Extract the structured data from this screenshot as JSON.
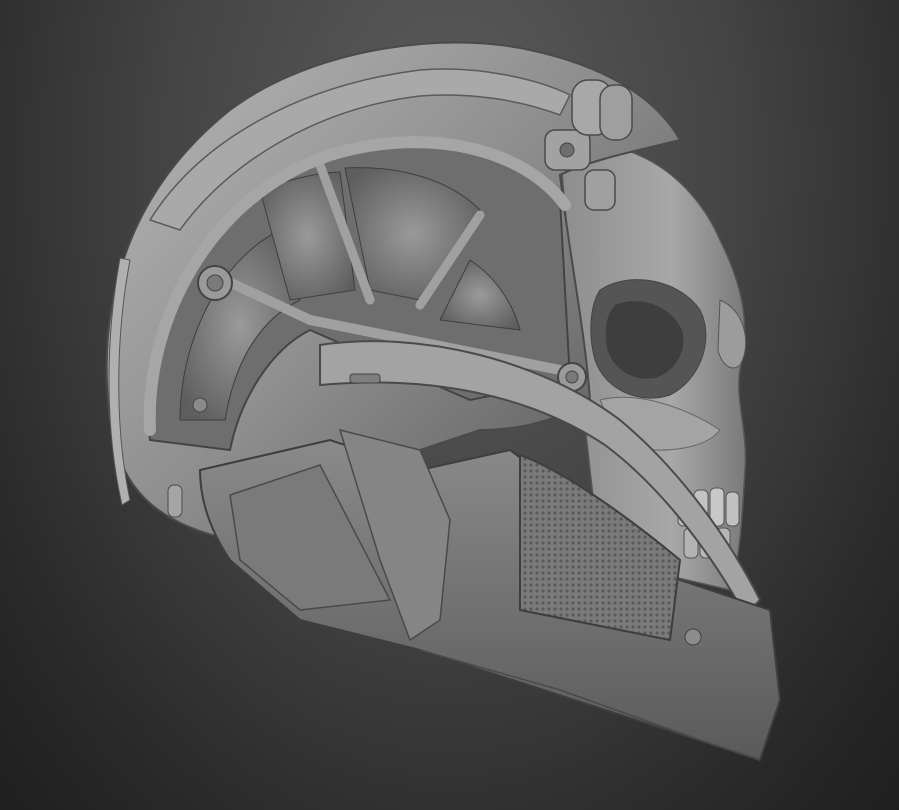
{
  "viewport": {
    "subject": "sculpted-helmet-skull",
    "background_top": "#5c5c5c",
    "background_bottom": "#1f1f1f",
    "material_base": "#8a8a8a",
    "material_highlight": "#c9c9c9",
    "material_shadow": "#3c3c3c"
  }
}
